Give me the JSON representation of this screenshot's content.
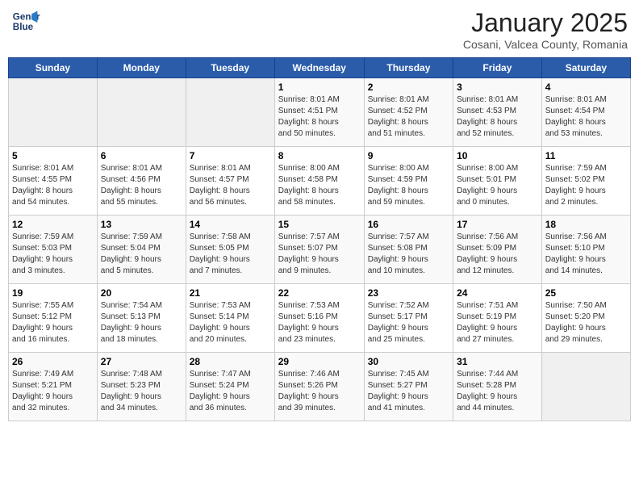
{
  "logo": {
    "line1": "General",
    "line2": "Blue"
  },
  "title": "January 2025",
  "subtitle": "Cosani, Valcea County, Romania",
  "weekdays": [
    "Sunday",
    "Monday",
    "Tuesday",
    "Wednesday",
    "Thursday",
    "Friday",
    "Saturday"
  ],
  "weeks": [
    [
      {
        "day": "",
        "info": ""
      },
      {
        "day": "",
        "info": ""
      },
      {
        "day": "",
        "info": ""
      },
      {
        "day": "1",
        "info": "Sunrise: 8:01 AM\nSunset: 4:51 PM\nDaylight: 8 hours\nand 50 minutes."
      },
      {
        "day": "2",
        "info": "Sunrise: 8:01 AM\nSunset: 4:52 PM\nDaylight: 8 hours\nand 51 minutes."
      },
      {
        "day": "3",
        "info": "Sunrise: 8:01 AM\nSunset: 4:53 PM\nDaylight: 8 hours\nand 52 minutes."
      },
      {
        "day": "4",
        "info": "Sunrise: 8:01 AM\nSunset: 4:54 PM\nDaylight: 8 hours\nand 53 minutes."
      }
    ],
    [
      {
        "day": "5",
        "info": "Sunrise: 8:01 AM\nSunset: 4:55 PM\nDaylight: 8 hours\nand 54 minutes."
      },
      {
        "day": "6",
        "info": "Sunrise: 8:01 AM\nSunset: 4:56 PM\nDaylight: 8 hours\nand 55 minutes."
      },
      {
        "day": "7",
        "info": "Sunrise: 8:01 AM\nSunset: 4:57 PM\nDaylight: 8 hours\nand 56 minutes."
      },
      {
        "day": "8",
        "info": "Sunrise: 8:00 AM\nSunset: 4:58 PM\nDaylight: 8 hours\nand 58 minutes."
      },
      {
        "day": "9",
        "info": "Sunrise: 8:00 AM\nSunset: 4:59 PM\nDaylight: 8 hours\nand 59 minutes."
      },
      {
        "day": "10",
        "info": "Sunrise: 8:00 AM\nSunset: 5:01 PM\nDaylight: 9 hours\nand 0 minutes."
      },
      {
        "day": "11",
        "info": "Sunrise: 7:59 AM\nSunset: 5:02 PM\nDaylight: 9 hours\nand 2 minutes."
      }
    ],
    [
      {
        "day": "12",
        "info": "Sunrise: 7:59 AM\nSunset: 5:03 PM\nDaylight: 9 hours\nand 3 minutes."
      },
      {
        "day": "13",
        "info": "Sunrise: 7:59 AM\nSunset: 5:04 PM\nDaylight: 9 hours\nand 5 minutes."
      },
      {
        "day": "14",
        "info": "Sunrise: 7:58 AM\nSunset: 5:05 PM\nDaylight: 9 hours\nand 7 minutes."
      },
      {
        "day": "15",
        "info": "Sunrise: 7:57 AM\nSunset: 5:07 PM\nDaylight: 9 hours\nand 9 minutes."
      },
      {
        "day": "16",
        "info": "Sunrise: 7:57 AM\nSunset: 5:08 PM\nDaylight: 9 hours\nand 10 minutes."
      },
      {
        "day": "17",
        "info": "Sunrise: 7:56 AM\nSunset: 5:09 PM\nDaylight: 9 hours\nand 12 minutes."
      },
      {
        "day": "18",
        "info": "Sunrise: 7:56 AM\nSunset: 5:10 PM\nDaylight: 9 hours\nand 14 minutes."
      }
    ],
    [
      {
        "day": "19",
        "info": "Sunrise: 7:55 AM\nSunset: 5:12 PM\nDaylight: 9 hours\nand 16 minutes."
      },
      {
        "day": "20",
        "info": "Sunrise: 7:54 AM\nSunset: 5:13 PM\nDaylight: 9 hours\nand 18 minutes."
      },
      {
        "day": "21",
        "info": "Sunrise: 7:53 AM\nSunset: 5:14 PM\nDaylight: 9 hours\nand 20 minutes."
      },
      {
        "day": "22",
        "info": "Sunrise: 7:53 AM\nSunset: 5:16 PM\nDaylight: 9 hours\nand 23 minutes."
      },
      {
        "day": "23",
        "info": "Sunrise: 7:52 AM\nSunset: 5:17 PM\nDaylight: 9 hours\nand 25 minutes."
      },
      {
        "day": "24",
        "info": "Sunrise: 7:51 AM\nSunset: 5:19 PM\nDaylight: 9 hours\nand 27 minutes."
      },
      {
        "day": "25",
        "info": "Sunrise: 7:50 AM\nSunset: 5:20 PM\nDaylight: 9 hours\nand 29 minutes."
      }
    ],
    [
      {
        "day": "26",
        "info": "Sunrise: 7:49 AM\nSunset: 5:21 PM\nDaylight: 9 hours\nand 32 minutes."
      },
      {
        "day": "27",
        "info": "Sunrise: 7:48 AM\nSunset: 5:23 PM\nDaylight: 9 hours\nand 34 minutes."
      },
      {
        "day": "28",
        "info": "Sunrise: 7:47 AM\nSunset: 5:24 PM\nDaylight: 9 hours\nand 36 minutes."
      },
      {
        "day": "29",
        "info": "Sunrise: 7:46 AM\nSunset: 5:26 PM\nDaylight: 9 hours\nand 39 minutes."
      },
      {
        "day": "30",
        "info": "Sunrise: 7:45 AM\nSunset: 5:27 PM\nDaylight: 9 hours\nand 41 minutes."
      },
      {
        "day": "31",
        "info": "Sunrise: 7:44 AM\nSunset: 5:28 PM\nDaylight: 9 hours\nand 44 minutes."
      },
      {
        "day": "",
        "info": ""
      }
    ]
  ]
}
